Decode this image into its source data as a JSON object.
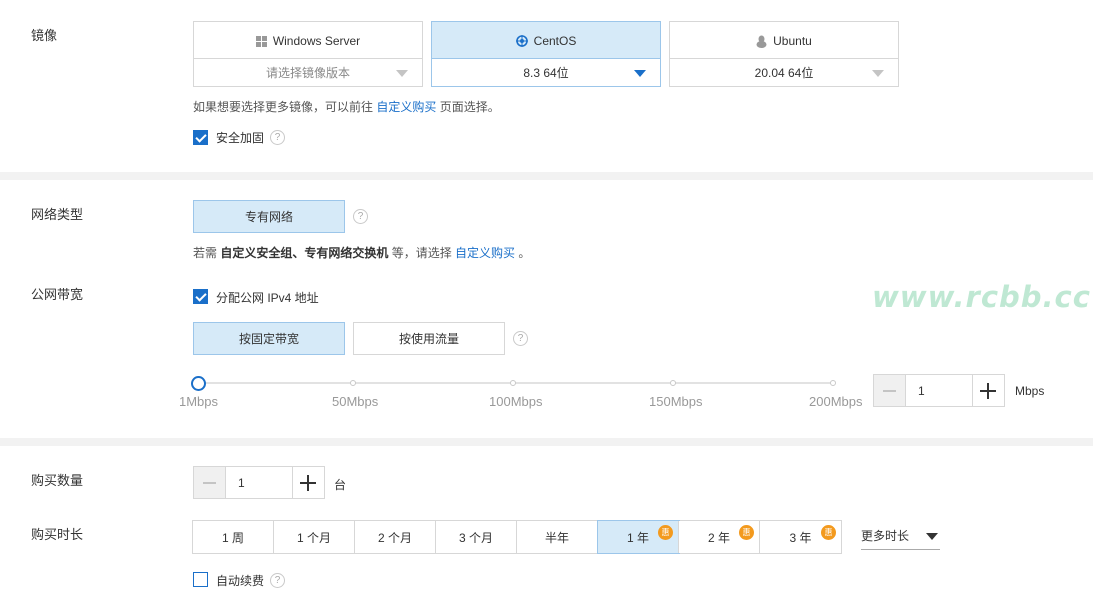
{
  "image_section": {
    "label": "镜像",
    "os_options": [
      {
        "name": "Windows Server",
        "icon": "windows-icon",
        "version": "请选择镜像版本",
        "selected": false
      },
      {
        "name": "CentOS",
        "icon": "centos-icon",
        "version": "8.3 64位",
        "selected": true
      },
      {
        "name": "Ubuntu",
        "icon": "ubuntu-icon",
        "version": "20.04 64位",
        "selected": false
      }
    ],
    "hint_prefix": "如果想要选择更多镜像，可以前往 ",
    "hint_link": "自定义购买",
    "hint_suffix": " 页面选择。",
    "security_label": "安全加固",
    "security_checked": true
  },
  "network": {
    "label": "网络类型",
    "vpc_button": "专有网络",
    "hint_prefix": "若需 ",
    "hint_bold": "自定义安全组、专有网络交换机",
    "hint_mid": " 等，请选择 ",
    "hint_link": "自定义购买",
    "hint_suffix": " 。"
  },
  "bandwidth": {
    "label": "公网带宽",
    "assign_ip_label": "分配公网 IPv4 地址",
    "assign_ip_checked": true,
    "fixed_button": "按固定带宽",
    "traffic_button": "按使用流量",
    "slider_ticks": [
      "1Mbps",
      "50Mbps",
      "100Mbps",
      "150Mbps",
      "200Mbps"
    ],
    "slider_value": 1,
    "value": "1",
    "unit": "Mbps"
  },
  "quantity": {
    "label": "购买数量",
    "value": "1",
    "unit": "台"
  },
  "duration": {
    "label": "购买时长",
    "options": [
      {
        "label": "1 周",
        "discount": false
      },
      {
        "label": "1 个月",
        "discount": false
      },
      {
        "label": "2 个月",
        "discount": false
      },
      {
        "label": "3 个月",
        "discount": false
      },
      {
        "label": "半年",
        "discount": false
      },
      {
        "label": "1 年",
        "discount": true
      },
      {
        "label": "2 年",
        "discount": true
      },
      {
        "label": "3 年",
        "discount": true
      }
    ],
    "selected": "1 年",
    "discount_badge": "惠",
    "more_label": "更多时长",
    "auto_renew_label": "自动续费",
    "auto_renew_checked": false
  },
  "watermark": "www.rcbb.cc",
  "help_icon": "?",
  "colors": {
    "accent": "#1a6fc9",
    "selected_bg": "#d6eaf8",
    "badge": "#f39a1e"
  }
}
